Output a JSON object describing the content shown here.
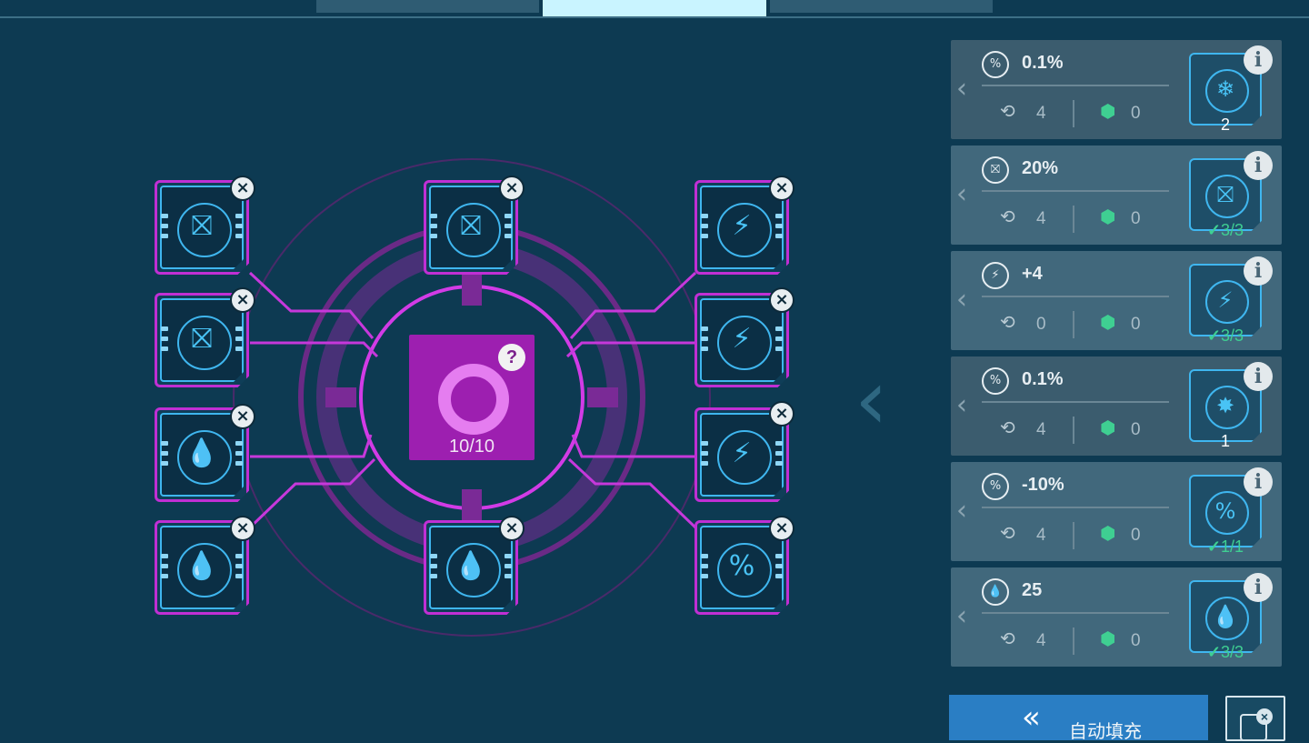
{
  "tabs": [
    {
      "label": ""
    },
    {
      "label": "",
      "active": true
    },
    {
      "label": ""
    }
  ],
  "core": {
    "count": "10/10",
    "help_label": "?",
    "icon": "ring-icon"
  },
  "close_label": "×",
  "slots": [
    {
      "icon": "anti-projectile-icon",
      "glyph": "⛝"
    },
    {
      "icon": "anti-projectile-icon",
      "glyph": "⛝"
    },
    {
      "icon": "regen-drop-icon",
      "glyph": "💧"
    },
    {
      "icon": "regen-drop-icon",
      "glyph": "💧"
    },
    {
      "icon": "anti-projectile-icon",
      "glyph": "⛝"
    },
    {
      "icon": "regen-drop-icon",
      "glyph": "💧"
    },
    {
      "icon": "energy-up-icon",
      "glyph": "⚡"
    },
    {
      "icon": "energy-up-icon",
      "glyph": "⚡"
    },
    {
      "icon": "energy-up-icon",
      "glyph": "⚡"
    },
    {
      "icon": "cooldown-percent-icon",
      "glyph": "%"
    }
  ],
  "modules": [
    {
      "effect_icon": "percent-icon",
      "effect_glyph": "%",
      "value": "0.1%",
      "cost_energy": "4",
      "cost_gem": "0",
      "chip_icon": "snowflake-icon",
      "chip_glyph": "❄",
      "quantity": "2",
      "check": false,
      "info_label": "i"
    },
    {
      "effect_icon": "anti-projectile-icon",
      "effect_glyph": "⛝",
      "value": "20%",
      "cost_energy": "4",
      "cost_gem": "0",
      "chip_icon": "anti-projectile-icon",
      "chip_glyph": "⛝",
      "quantity": "3/3",
      "check": true,
      "info_label": "i"
    },
    {
      "effect_icon": "energy-up-icon",
      "effect_glyph": "⚡",
      "value": "+4",
      "cost_energy": "0",
      "cost_gem": "0",
      "chip_icon": "energy-up-icon",
      "chip_glyph": "⚡",
      "quantity": "3/3",
      "check": true,
      "info_label": "i"
    },
    {
      "effect_icon": "percent-icon",
      "effect_glyph": "%",
      "value": "0.1%",
      "cost_energy": "4",
      "cost_gem": "0",
      "chip_icon": "burst-icon",
      "chip_glyph": "✸",
      "quantity": "1",
      "check": false,
      "info_label": "i"
    },
    {
      "effect_icon": "cooldown-percent-icon",
      "effect_glyph": "%",
      "value": "-10%",
      "cost_energy": "4",
      "cost_gem": "0",
      "chip_icon": "cooldown-percent-icon",
      "chip_glyph": "%",
      "quantity": "1/1",
      "check": true,
      "info_label": "i"
    },
    {
      "effect_icon": "regen-drop-icon",
      "effect_glyph": "💧",
      "value": "25",
      "cost_energy": "4",
      "cost_gem": "0",
      "chip_icon": "regen-drop-icon",
      "chip_glyph": "💧",
      "quantity": "3/3",
      "check": true,
      "info_label": "i"
    }
  ],
  "cost_icons": {
    "energy": "energy-recycle-icon",
    "gem": "gem-icon"
  },
  "autofill": {
    "label": "自动填充",
    "icon": "double-chevron-left-icon"
  },
  "clear_button": {
    "icon": "clear-modules-icon"
  },
  "colors": {
    "accent_magenta": "#c02fd4",
    "accent_blue": "#3fb6ef",
    "check_green": "#3fcf92",
    "background": "#0d3a52"
  }
}
